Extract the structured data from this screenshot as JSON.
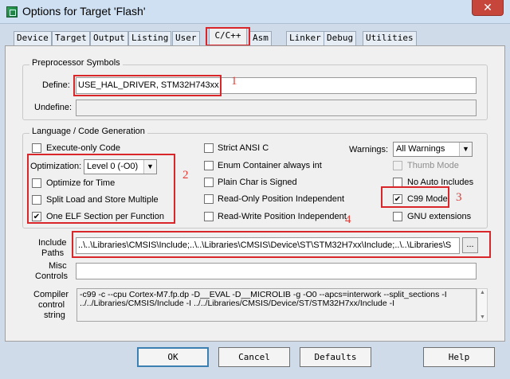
{
  "window": {
    "title": "Options for Target 'Flash'",
    "close_glyph": "✕"
  },
  "tabs": [
    "Device",
    "Target",
    "Output",
    "Listing",
    "User",
    "C/C++",
    "Asm",
    "Linker",
    "Debug",
    "Utilities"
  ],
  "preprocessor": {
    "group_label": "Preprocessor Symbols",
    "define_label": "Define:",
    "define_value": "USE_HAL_DRIVER, STM32H743xx",
    "undefine_label": "Undefine:",
    "undefine_value": ""
  },
  "language": {
    "group_label": "Language / Code Generation",
    "execute_only": {
      "label": "Execute-only Code",
      "checked": false
    },
    "optimization_label": "Optimization:",
    "optimization_value": "Level 0 (-O0)",
    "optimize_for_time": {
      "label": "Optimize for Time",
      "checked": false
    },
    "split_load_store": {
      "label": "Split Load and Store Multiple",
      "checked": false
    },
    "one_elf_section": {
      "label": "One ELF Section per Function",
      "checked": true
    },
    "strict_ansi": {
      "label": "Strict ANSI C",
      "checked": false
    },
    "enum_container": {
      "label": "Enum Container always int",
      "checked": false
    },
    "plain_char_signed": {
      "label": "Plain Char is Signed",
      "checked": false
    },
    "ro_pos_indep": {
      "label": "Read-Only Position Independent",
      "checked": false
    },
    "rw_pos_indep": {
      "label": "Read-Write Position Independent",
      "checked": false
    },
    "warnings_label": "Warnings:",
    "warnings_value": "All Warnings",
    "thumb_mode": {
      "label": "Thumb Mode",
      "checked": false,
      "disabled": true
    },
    "no_auto_includes": {
      "label": "No Auto Includes",
      "checked": false
    },
    "c99_mode": {
      "label": "C99 Mode",
      "checked": true
    },
    "gnu_extensions": {
      "label": "GNU extensions",
      "checked": false
    }
  },
  "include": {
    "label_line1": "Include",
    "label_line2": "Paths",
    "value": "..\\..\\Libraries\\CMSIS\\Include;..\\..\\Libraries\\CMSIS\\Device\\ST\\STM32H7xx\\Include;..\\..\\Libraries\\S",
    "browse_label": "..."
  },
  "misc": {
    "label_line1": "Misc",
    "label_line2": "Controls",
    "value": ""
  },
  "compiler": {
    "label_line1": "Compiler",
    "label_line2": "control",
    "label_line3": "string",
    "line1": "-c99 -c --cpu Cortex-M7.fp.dp -D__EVAL -D__MICROLIB -g -O0 --apcs=interwork --split_sections -I",
    "line2": "../../Libraries/CMSIS/Include -I ../../Libraries/CMSIS/Device/ST/STM32H7xx/Include -I"
  },
  "annotations": [
    "1",
    "2",
    "3",
    "4"
  ],
  "buttons": {
    "ok": "OK",
    "cancel": "Cancel",
    "defaults": "Defaults",
    "help": "Help"
  },
  "colors": {
    "annotation": "#d9262b",
    "titlebar": "#cfe0f2",
    "close": "#c7463c"
  }
}
